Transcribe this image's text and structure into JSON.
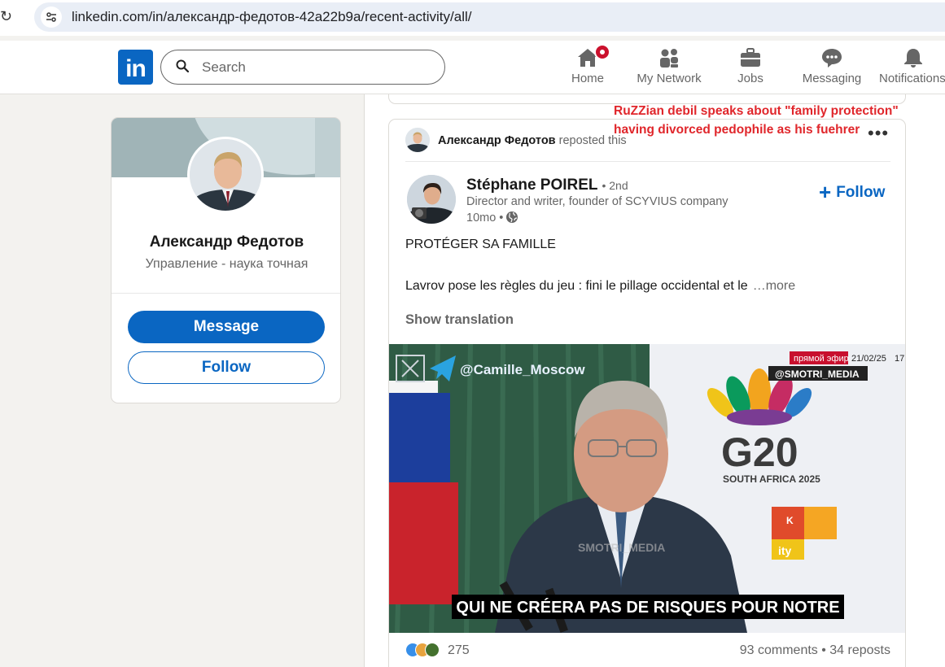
{
  "browser": {
    "url": "linkedin.com/in/александр-федотов-42a22b9a/recent-activity/all/"
  },
  "nav": {
    "logo_text": "in",
    "search_placeholder": "Search",
    "items": [
      {
        "label": "Home",
        "icon": "home-icon"
      },
      {
        "label": "My Network",
        "icon": "network-icon"
      },
      {
        "label": "Jobs",
        "icon": "briefcase-icon"
      },
      {
        "label": "Messaging",
        "icon": "messaging-icon"
      },
      {
        "label": "Notifications",
        "icon": "bell-icon"
      }
    ]
  },
  "profile": {
    "name": "Александр Федотов",
    "headline": "Управление - наука точная",
    "message_label": "Message",
    "follow_label": "Follow"
  },
  "annotation": {
    "line1": "RuZZian debil speaks about \"family protection\"",
    "line2": "having divorced pedophile as his fuehrer"
  },
  "post": {
    "repost_name": "Александр Федотов",
    "repost_suffix": "reposted this",
    "more_label": "•••",
    "author": {
      "name": "Stéphane POIREL",
      "degree": "• 2nd",
      "title": "Director and writer, founder of SCYVIUS company",
      "time": "10mo •"
    },
    "follow_label": "Follow",
    "text_line1": "PROTÉGER SA FAMILLE",
    "text_line2": "Lavrov pose les règles du jeu : fini le pillage occidental et le",
    "see_more": "…more",
    "show_translation": "Show translation",
    "video": {
      "handle": "@Camille_Moscow",
      "live_label": "прямой эфир",
      "date": "21/02/25",
      "time_fragment": "17:",
      "channel": "@SMOTRI_MEDIA",
      "watermark": "SMOTRI_MEDIA",
      "backdrop_title": "G20",
      "backdrop_subtitle": "SOUTH AFRICA 2025",
      "backdrop_fragment_top": "K",
      "backdrop_fragment_bottom": "ity",
      "subtitle": "QUI NE CRÉERA PAS DE RISQUES POUR NOTRE"
    },
    "reaction_count": "275",
    "comments_reposts": "93 comments • 34 reposts",
    "colors": {
      "accent": "#0a66c2",
      "annotation": "#e0262b",
      "notification_badge": "#cb112d"
    }
  }
}
